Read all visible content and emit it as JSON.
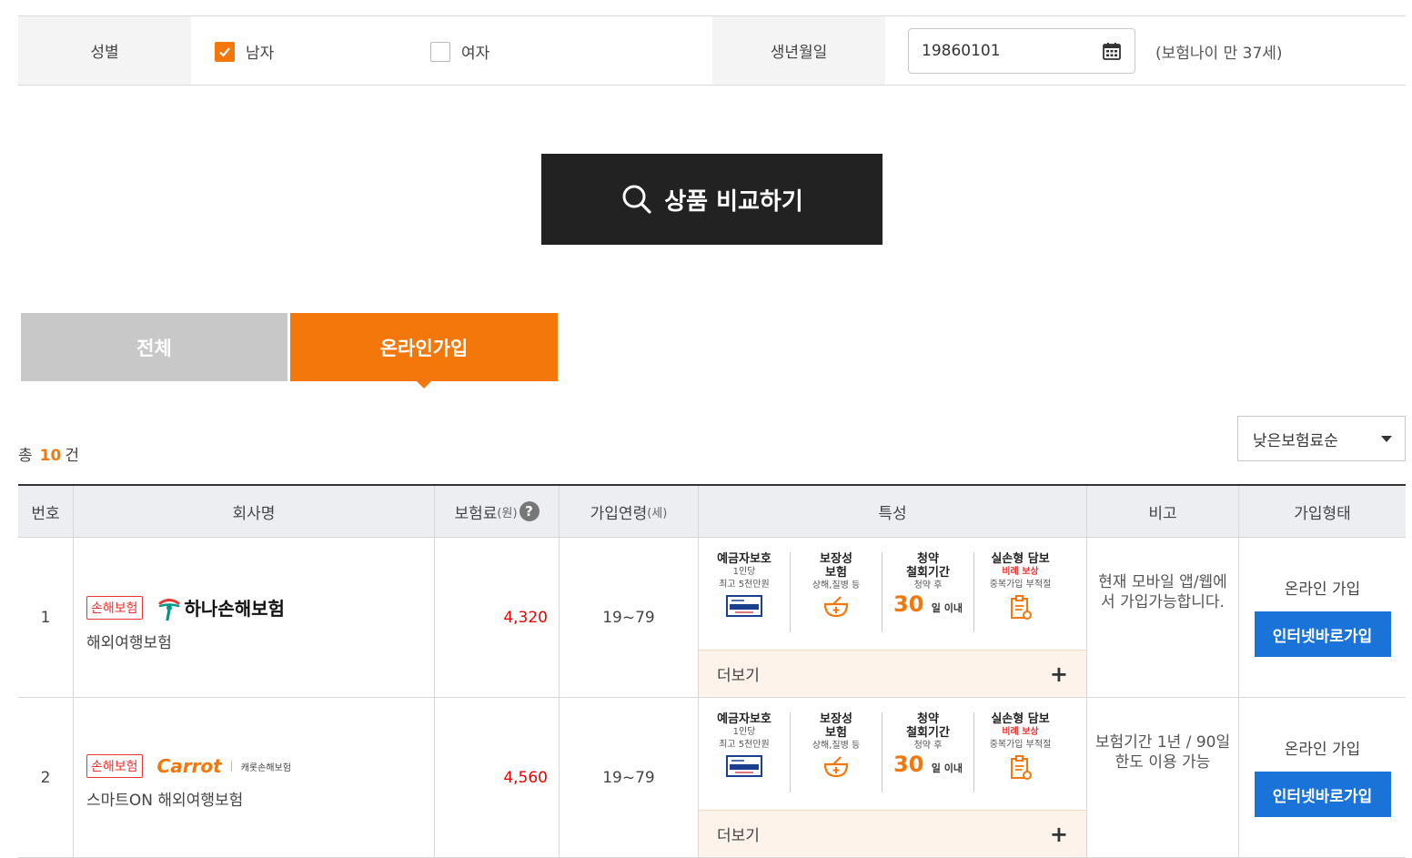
{
  "form": {
    "gender_label": "성별",
    "male_label": "남자",
    "female_label": "여자",
    "male_checked": true,
    "female_checked": false,
    "birth_label": "생년월일",
    "birth_value": "19860101",
    "age_note": "(보험나이 만 37세)"
  },
  "compare_button": "상품 비교하기",
  "tabs": [
    {
      "label": "전체",
      "active": false
    },
    {
      "label": "온라인가입",
      "active": true
    }
  ],
  "summary": {
    "prefix": "총",
    "count": "10",
    "suffix": "건",
    "sort_selected": "낮은보험료순"
  },
  "table": {
    "headers": {
      "no": "번호",
      "company": "회사명",
      "premium": "보험료",
      "premium_unit": "(원)",
      "premium_help": "?",
      "age": "가입연령",
      "age_unit": "(세)",
      "features": "특성",
      "note": "비고",
      "join": "가입형태"
    },
    "features_labels": {
      "f1_title": "예금자보호",
      "f1_sub1": "1인당",
      "f1_sub2": "최고 5천만원",
      "f2_title1": "보장성",
      "f2_title2": "보험",
      "f2_sub": "상해,질병 등",
      "f3_title1": "청약",
      "f3_title2": "철회기간",
      "f3_sub": "청약 후",
      "f3_big": "30",
      "f3_unit": "일 이내",
      "f4_title": "실손형 담보",
      "f4_red": "비례 보상",
      "f4_sub": "중복가입 부적절"
    },
    "more_label": "더보기",
    "rows": [
      {
        "no": "1",
        "badge": "손해보험",
        "company": "하나손해보험",
        "product": "해외여행보험",
        "premium": "4,320",
        "age": "19~79",
        "note": "현재 모바일 앱/웹에서 가입가능합니다.",
        "join_type": "온라인 가입",
        "join_button": "인터넷바로가입"
      },
      {
        "no": "2",
        "badge": "손해보험",
        "company": "Carrot",
        "company_sub": "캐롯손해보험",
        "product": "스마트ON 해외여행보험",
        "premium": "4,560",
        "age": "19~79",
        "note": "보험기간 1년 / 90일 한도 이용 가능",
        "join_type": "온라인 가입",
        "join_button": "인터넷바로가입"
      }
    ]
  },
  "colors": {
    "accent": "#f4770b",
    "dark_button": "#222222",
    "join_button": "#1a73d8",
    "price_red": "#e00000"
  }
}
